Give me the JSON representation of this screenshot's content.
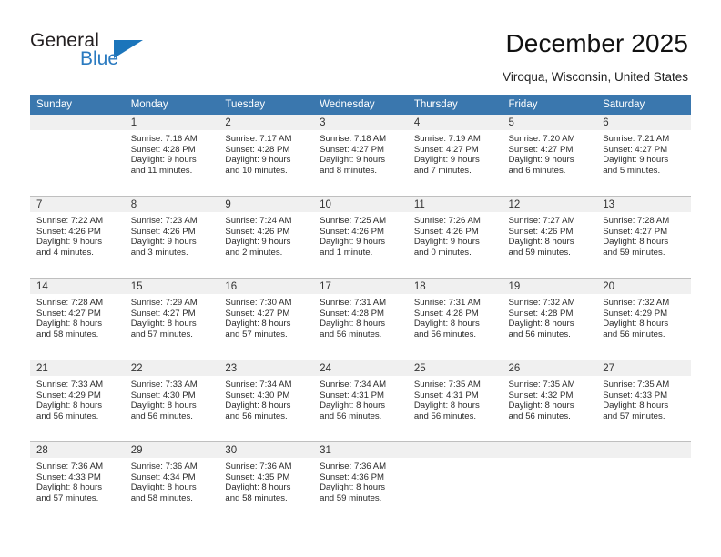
{
  "brand": {
    "name_top": "General",
    "name_bottom": "Blue",
    "triangle_color": "#1b75bb",
    "blue_text_color": "#2a7ac0"
  },
  "header": {
    "title": "December 2025",
    "location": "Viroqua, Wisconsin, United States"
  },
  "theme": {
    "header_row_bg": "#3a77ae",
    "header_row_text": "#ffffff",
    "daynum_band_bg": "#f0f0f0",
    "row_divider": "#bfbfbf"
  },
  "weekdays": [
    "Sunday",
    "Monday",
    "Tuesday",
    "Wednesday",
    "Thursday",
    "Friday",
    "Saturday"
  ],
  "weeks": [
    [
      {
        "day": "",
        "sunrise": "",
        "sunset": "",
        "daylight_line1": "",
        "daylight_line2": ""
      },
      {
        "day": "1",
        "sunrise": "Sunrise: 7:16 AM",
        "sunset": "Sunset: 4:28 PM",
        "daylight_line1": "Daylight: 9 hours",
        "daylight_line2": "and 11 minutes."
      },
      {
        "day": "2",
        "sunrise": "Sunrise: 7:17 AM",
        "sunset": "Sunset: 4:28 PM",
        "daylight_line1": "Daylight: 9 hours",
        "daylight_line2": "and 10 minutes."
      },
      {
        "day": "3",
        "sunrise": "Sunrise: 7:18 AM",
        "sunset": "Sunset: 4:27 PM",
        "daylight_line1": "Daylight: 9 hours",
        "daylight_line2": "and 8 minutes."
      },
      {
        "day": "4",
        "sunrise": "Sunrise: 7:19 AM",
        "sunset": "Sunset: 4:27 PM",
        "daylight_line1": "Daylight: 9 hours",
        "daylight_line2": "and 7 minutes."
      },
      {
        "day": "5",
        "sunrise": "Sunrise: 7:20 AM",
        "sunset": "Sunset: 4:27 PM",
        "daylight_line1": "Daylight: 9 hours",
        "daylight_line2": "and 6 minutes."
      },
      {
        "day": "6",
        "sunrise": "Sunrise: 7:21 AM",
        "sunset": "Sunset: 4:27 PM",
        "daylight_line1": "Daylight: 9 hours",
        "daylight_line2": "and 5 minutes."
      }
    ],
    [
      {
        "day": "7",
        "sunrise": "Sunrise: 7:22 AM",
        "sunset": "Sunset: 4:26 PM",
        "daylight_line1": "Daylight: 9 hours",
        "daylight_line2": "and 4 minutes."
      },
      {
        "day": "8",
        "sunrise": "Sunrise: 7:23 AM",
        "sunset": "Sunset: 4:26 PM",
        "daylight_line1": "Daylight: 9 hours",
        "daylight_line2": "and 3 minutes."
      },
      {
        "day": "9",
        "sunrise": "Sunrise: 7:24 AM",
        "sunset": "Sunset: 4:26 PM",
        "daylight_line1": "Daylight: 9 hours",
        "daylight_line2": "and 2 minutes."
      },
      {
        "day": "10",
        "sunrise": "Sunrise: 7:25 AM",
        "sunset": "Sunset: 4:26 PM",
        "daylight_line1": "Daylight: 9 hours",
        "daylight_line2": "and 1 minute."
      },
      {
        "day": "11",
        "sunrise": "Sunrise: 7:26 AM",
        "sunset": "Sunset: 4:26 PM",
        "daylight_line1": "Daylight: 9 hours",
        "daylight_line2": "and 0 minutes."
      },
      {
        "day": "12",
        "sunrise": "Sunrise: 7:27 AM",
        "sunset": "Sunset: 4:26 PM",
        "daylight_line1": "Daylight: 8 hours",
        "daylight_line2": "and 59 minutes."
      },
      {
        "day": "13",
        "sunrise": "Sunrise: 7:28 AM",
        "sunset": "Sunset: 4:27 PM",
        "daylight_line1": "Daylight: 8 hours",
        "daylight_line2": "and 59 minutes."
      }
    ],
    [
      {
        "day": "14",
        "sunrise": "Sunrise: 7:28 AM",
        "sunset": "Sunset: 4:27 PM",
        "daylight_line1": "Daylight: 8 hours",
        "daylight_line2": "and 58 minutes."
      },
      {
        "day": "15",
        "sunrise": "Sunrise: 7:29 AM",
        "sunset": "Sunset: 4:27 PM",
        "daylight_line1": "Daylight: 8 hours",
        "daylight_line2": "and 57 minutes."
      },
      {
        "day": "16",
        "sunrise": "Sunrise: 7:30 AM",
        "sunset": "Sunset: 4:27 PM",
        "daylight_line1": "Daylight: 8 hours",
        "daylight_line2": "and 57 minutes."
      },
      {
        "day": "17",
        "sunrise": "Sunrise: 7:31 AM",
        "sunset": "Sunset: 4:28 PM",
        "daylight_line1": "Daylight: 8 hours",
        "daylight_line2": "and 56 minutes."
      },
      {
        "day": "18",
        "sunrise": "Sunrise: 7:31 AM",
        "sunset": "Sunset: 4:28 PM",
        "daylight_line1": "Daylight: 8 hours",
        "daylight_line2": "and 56 minutes."
      },
      {
        "day": "19",
        "sunrise": "Sunrise: 7:32 AM",
        "sunset": "Sunset: 4:28 PM",
        "daylight_line1": "Daylight: 8 hours",
        "daylight_line2": "and 56 minutes."
      },
      {
        "day": "20",
        "sunrise": "Sunrise: 7:32 AM",
        "sunset": "Sunset: 4:29 PM",
        "daylight_line1": "Daylight: 8 hours",
        "daylight_line2": "and 56 minutes."
      }
    ],
    [
      {
        "day": "21",
        "sunrise": "Sunrise: 7:33 AM",
        "sunset": "Sunset: 4:29 PM",
        "daylight_line1": "Daylight: 8 hours",
        "daylight_line2": "and 56 minutes."
      },
      {
        "day": "22",
        "sunrise": "Sunrise: 7:33 AM",
        "sunset": "Sunset: 4:30 PM",
        "daylight_line1": "Daylight: 8 hours",
        "daylight_line2": "and 56 minutes."
      },
      {
        "day": "23",
        "sunrise": "Sunrise: 7:34 AM",
        "sunset": "Sunset: 4:30 PM",
        "daylight_line1": "Daylight: 8 hours",
        "daylight_line2": "and 56 minutes."
      },
      {
        "day": "24",
        "sunrise": "Sunrise: 7:34 AM",
        "sunset": "Sunset: 4:31 PM",
        "daylight_line1": "Daylight: 8 hours",
        "daylight_line2": "and 56 minutes."
      },
      {
        "day": "25",
        "sunrise": "Sunrise: 7:35 AM",
        "sunset": "Sunset: 4:31 PM",
        "daylight_line1": "Daylight: 8 hours",
        "daylight_line2": "and 56 minutes."
      },
      {
        "day": "26",
        "sunrise": "Sunrise: 7:35 AM",
        "sunset": "Sunset: 4:32 PM",
        "daylight_line1": "Daylight: 8 hours",
        "daylight_line2": "and 56 minutes."
      },
      {
        "day": "27",
        "sunrise": "Sunrise: 7:35 AM",
        "sunset": "Sunset: 4:33 PM",
        "daylight_line1": "Daylight: 8 hours",
        "daylight_line2": "and 57 minutes."
      }
    ],
    [
      {
        "day": "28",
        "sunrise": "Sunrise: 7:36 AM",
        "sunset": "Sunset: 4:33 PM",
        "daylight_line1": "Daylight: 8 hours",
        "daylight_line2": "and 57 minutes."
      },
      {
        "day": "29",
        "sunrise": "Sunrise: 7:36 AM",
        "sunset": "Sunset: 4:34 PM",
        "daylight_line1": "Daylight: 8 hours",
        "daylight_line2": "and 58 minutes."
      },
      {
        "day": "30",
        "sunrise": "Sunrise: 7:36 AM",
        "sunset": "Sunset: 4:35 PM",
        "daylight_line1": "Daylight: 8 hours",
        "daylight_line2": "and 58 minutes."
      },
      {
        "day": "31",
        "sunrise": "Sunrise: 7:36 AM",
        "sunset": "Sunset: 4:36 PM",
        "daylight_line1": "Daylight: 8 hours",
        "daylight_line2": "and 59 minutes."
      },
      {
        "day": "",
        "sunrise": "",
        "sunset": "",
        "daylight_line1": "",
        "daylight_line2": ""
      },
      {
        "day": "",
        "sunrise": "",
        "sunset": "",
        "daylight_line1": "",
        "daylight_line2": ""
      },
      {
        "day": "",
        "sunrise": "",
        "sunset": "",
        "daylight_line1": "",
        "daylight_line2": ""
      }
    ]
  ]
}
